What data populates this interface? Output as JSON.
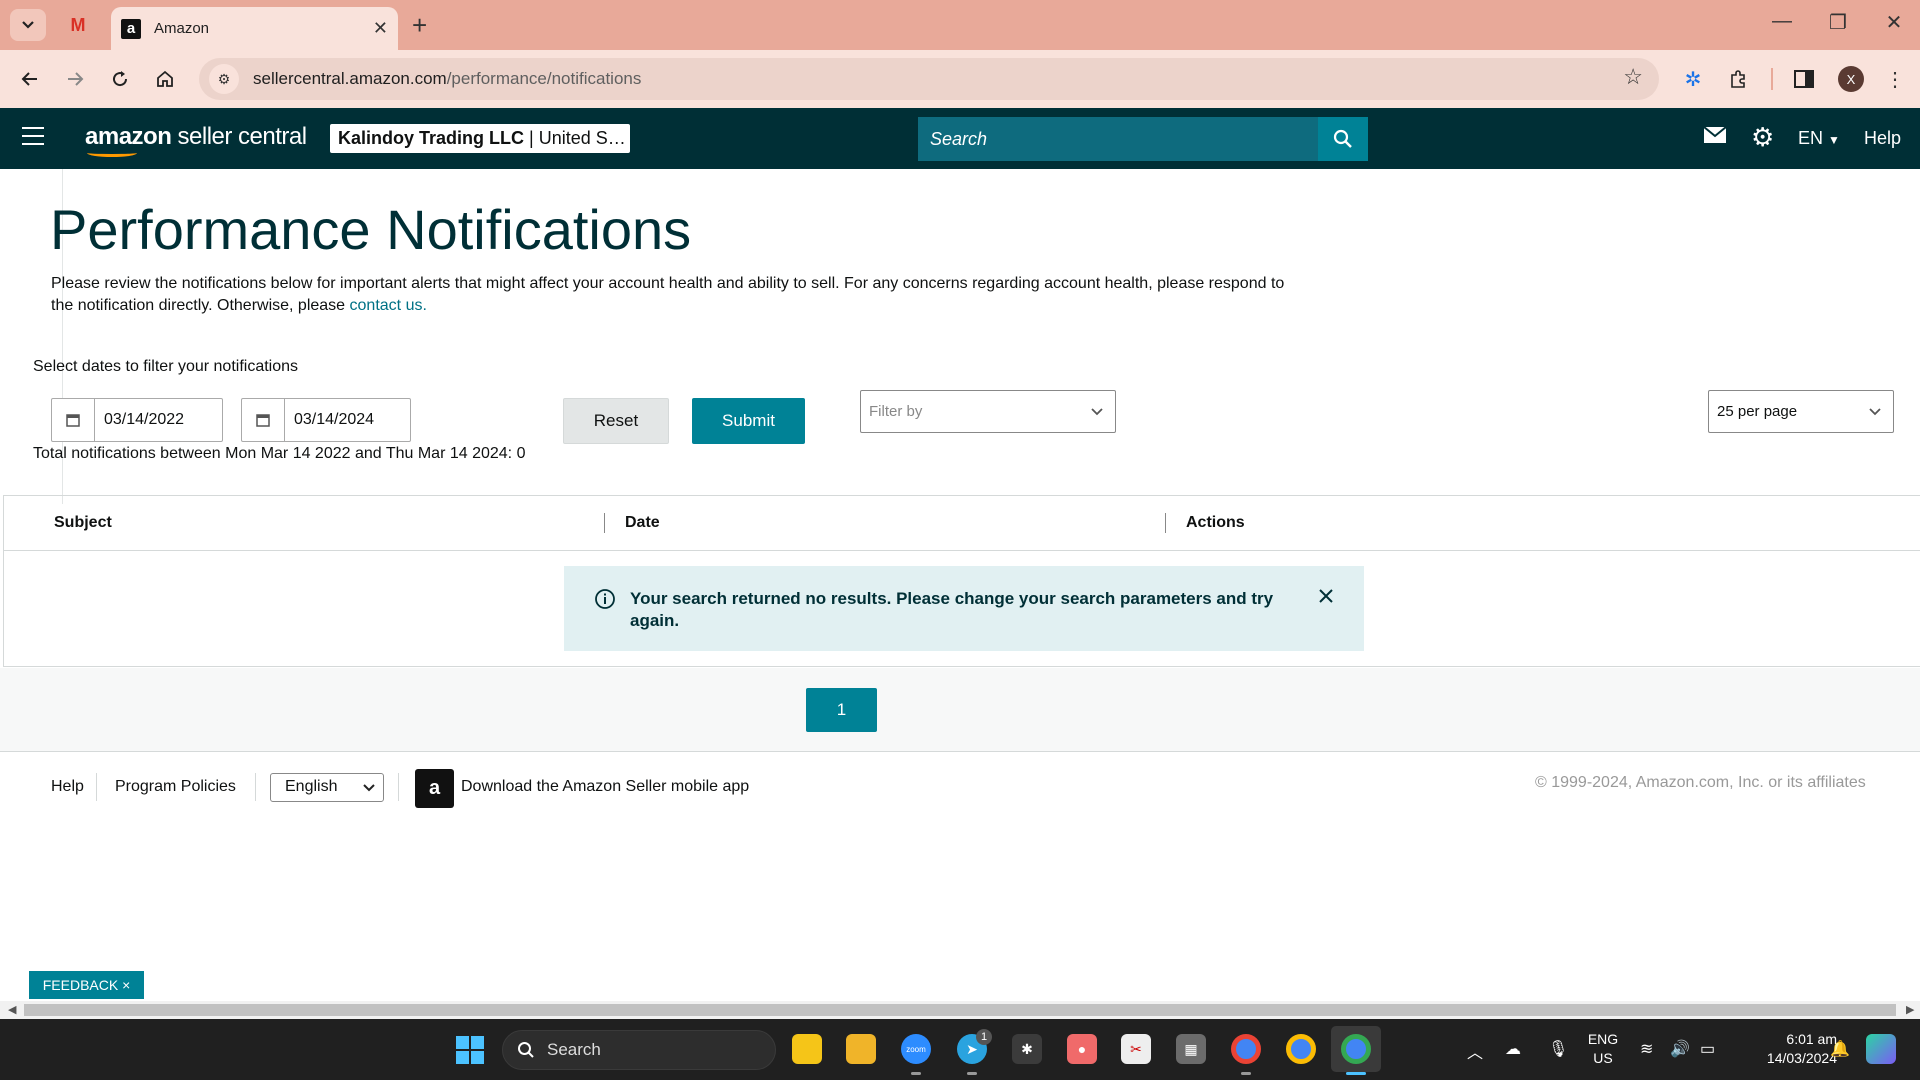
{
  "browser": {
    "tab_title": "Amazon",
    "tab_favicon_letter": "a",
    "gmail_label": "M",
    "url_host": "sellercentral.amazon.com",
    "url_path": "/performance/notifications",
    "profile_initial": "X"
  },
  "header": {
    "logo_bold": "amazon",
    "logo_rest": " seller central",
    "account_name": "Kalindoy Trading LLC",
    "account_region": "United S…",
    "search_placeholder": "Search",
    "language": "EN",
    "help": "Help"
  },
  "page": {
    "title": "Performance Notifications",
    "intro": "Please review the notifications below for important alerts that might affect your account health and ability to sell. For any concerns regarding account health, please respond to the notification directly. Otherwise, please",
    "contact_link": "contact us.",
    "filter_label": "Select dates to filter your notifications",
    "start_date": "03/14/2022",
    "end_date": "03/14/2024",
    "reset_label": "Reset",
    "submit_label": "Submit",
    "filter_by_placeholder": "Filter by",
    "per_page": "25 per page",
    "total_text": "Total notifications between Mon Mar 14 2022 and Thu Mar 14 2024: 0"
  },
  "table": {
    "columns": [
      "Subject",
      "Date",
      "Actions"
    ],
    "no_results": "Your search returned no results. Please change your search parameters and try again."
  },
  "pagination": {
    "current_page": "1"
  },
  "footer": {
    "help": "Help",
    "program_policies": "Program Policies",
    "language": "English",
    "app_text": "Download the Amazon Seller mobile app",
    "copyright": "© 1999-2024, Amazon.com, Inc. or its affiliates"
  },
  "feedback_label": "FEEDBACK ×",
  "taskbar": {
    "search_label": "Search",
    "telegram_badge": "1",
    "lang_top": "ENG",
    "lang_bottom": "US",
    "time": "6:01 am",
    "date": "14/03/2024"
  },
  "colors": {
    "header_bg": "#002f36",
    "accent": "#008296",
    "tabbar_bg": "#e8a999",
    "alert_bg": "#e1f0f2"
  }
}
